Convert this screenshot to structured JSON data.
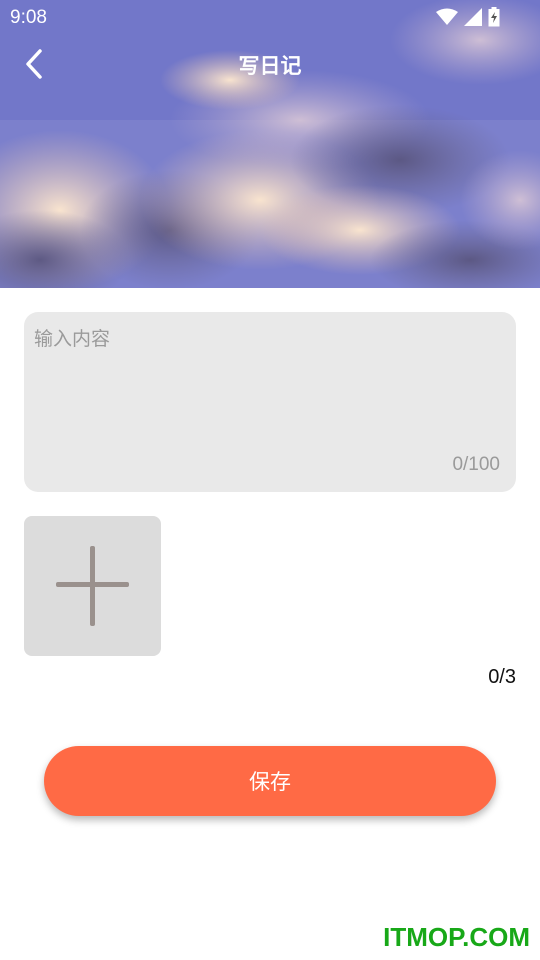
{
  "status_bar": {
    "time": "9:08",
    "icons": [
      "wifi-icon",
      "cellular-signal-icon",
      "battery-charging-icon"
    ]
  },
  "header": {
    "title": "写日记",
    "back_icon": "chevron-left-icon",
    "background": "sky-clouds-photo"
  },
  "editor": {
    "placeholder": "输入内容",
    "value": "",
    "char_count": "0/100"
  },
  "photos": {
    "add_icon": "plus-icon",
    "count": "0/3"
  },
  "actions": {
    "save_label": "保存"
  },
  "watermark": {
    "text": "ITMOP.COM"
  },
  "colors": {
    "accent": "#ff6a45",
    "input_bg": "#e9e9e9",
    "add_tile_bg": "#dcdcdc",
    "watermark": "#18a818"
  }
}
